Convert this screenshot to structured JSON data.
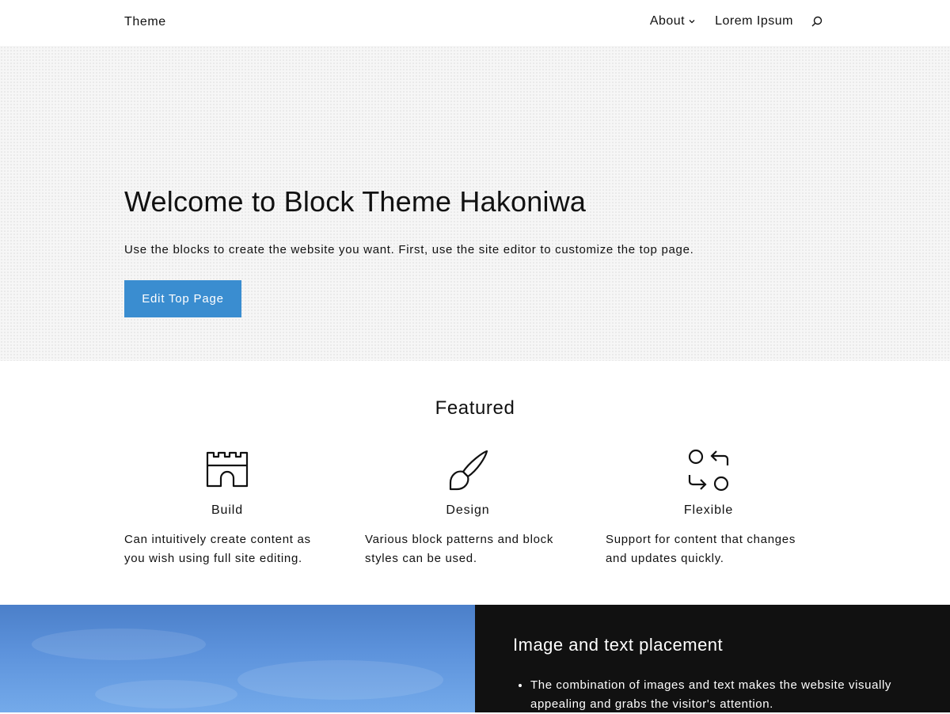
{
  "header": {
    "site_title": "Theme",
    "nav": [
      {
        "label": "About",
        "has_submenu": true
      },
      {
        "label": "Lorem Ipsum",
        "has_submenu": false
      }
    ],
    "search_icon": "search-icon"
  },
  "hero": {
    "title": "Welcome to Block Theme Hakoniwa",
    "description": "Use the blocks to create the website you want. First, use the site editor to customize the top page.",
    "button_label": "Edit Top Page",
    "button_color": "#3a8dd0"
  },
  "featured": {
    "heading": "Featured",
    "items": [
      {
        "icon": "castle-icon",
        "title": "Build",
        "text": "Can intuitively create content as you wish using full site editing."
      },
      {
        "icon": "brush-icon",
        "title": "Design",
        "text": "Various block patterns and block styles can be used."
      },
      {
        "icon": "flexible-arrows-icon",
        "title": "Flexible",
        "text": "Support for content that changes and updates quickly."
      }
    ]
  },
  "media_text": {
    "heading": "Image and text placement",
    "bullets": [
      "The combination of images and text makes the website visually appealing and grabs the visitor's attention."
    ],
    "panel_color": "#111111"
  }
}
